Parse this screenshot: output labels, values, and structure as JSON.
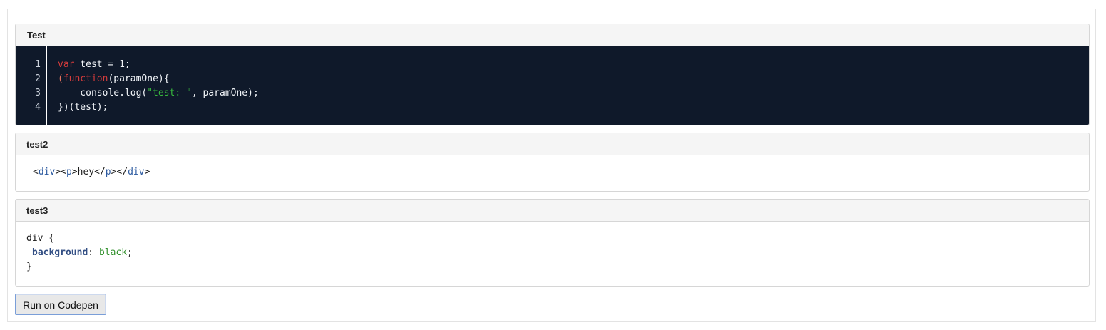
{
  "panels": {
    "js": {
      "title": "Test",
      "line_numbers": [
        "1",
        "2",
        "3",
        "4"
      ],
      "tokens": {
        "l1_kw": "var",
        "l1_rest": " test = 1;",
        "l2_paren": "(",
        "l2_kw": "function",
        "l2_rest": "(paramOne){",
        "l3_pre": "    console.log(",
        "l3_str": "\"test: \"",
        "l3_post": ", paramOne);",
        "l4": "})(test);"
      }
    },
    "html": {
      "title": "test2",
      "tokens": {
        "t1": "<",
        "t2": "div",
        "t3": ">",
        "t4": "<",
        "t5": "p",
        "t6": ">",
        "t7": "hey",
        "t8": "</",
        "t9": "p",
        "t10": ">",
        "t11": "</",
        "t12": "div",
        "t13": ">"
      }
    },
    "css": {
      "title": "test3",
      "tokens": {
        "l1": "div {",
        "l2_prop": "background",
        "l2_colon": ": ",
        "l2_val": "black",
        "l2_semi": ";",
        "l3": "}"
      }
    }
  },
  "actions": {
    "run_label": "Run on Codepen"
  }
}
